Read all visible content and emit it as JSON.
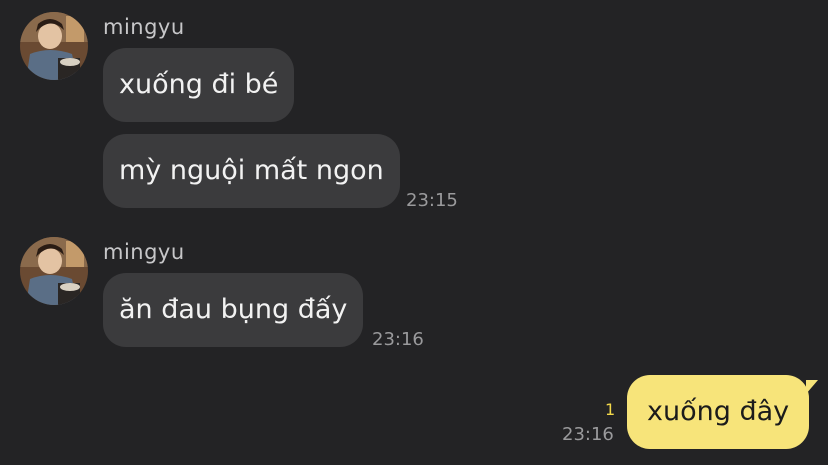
{
  "theme": {
    "background": "#232325",
    "incoming_bubble": "#3b3b3d",
    "outgoing_bubble": "#f7e47a",
    "incoming_text": "#f2f2f2",
    "outgoing_text": "#1b1b1b",
    "sender_name": "#c7c7c9",
    "timestamp": "#9a9a9c",
    "unread_count": "#f3d94a"
  },
  "groups": [
    {
      "sender": "mingyu",
      "avatar_icon": "profile-photo-icon",
      "messages": [
        {
          "text": "xuống đi bé"
        },
        {
          "text": "mỳ nguội mất ngon",
          "time": "23:15"
        }
      ]
    },
    {
      "sender": "mingyu",
      "avatar_icon": "profile-photo-icon",
      "messages": [
        {
          "text": "ăn đau bụng đấy",
          "time": "23:16"
        }
      ]
    }
  ],
  "outgoing": [
    {
      "text": "xuống đây",
      "time": "23:16",
      "unread": "1"
    }
  ]
}
